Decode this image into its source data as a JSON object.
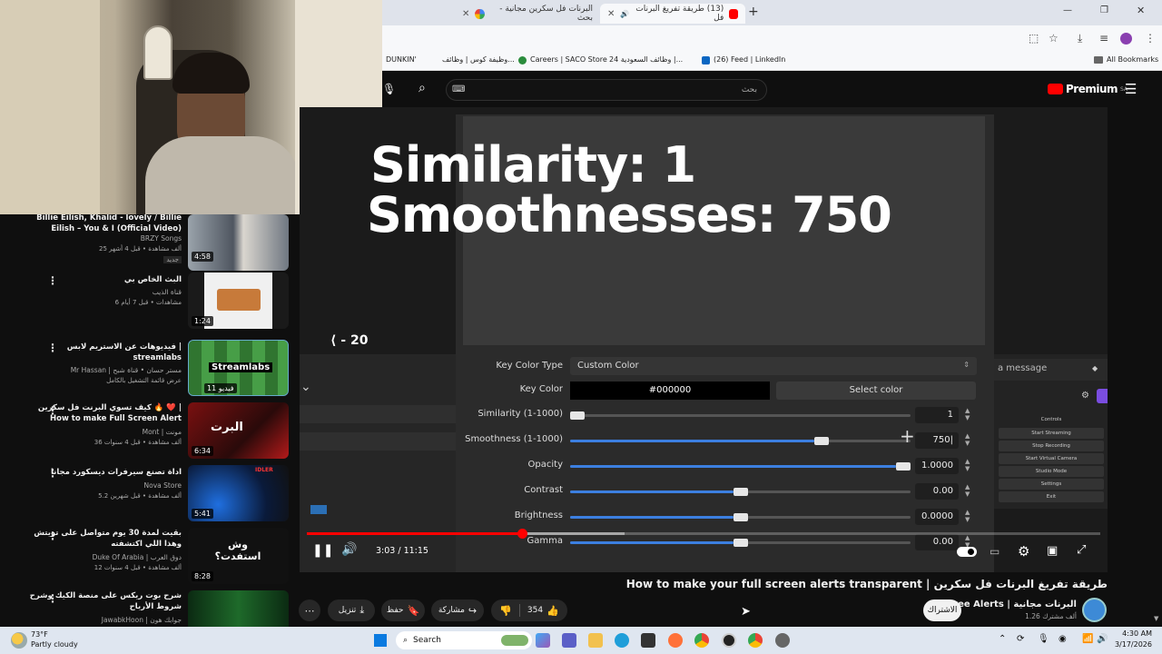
{
  "browser": {
    "tabs": [
      {
        "label": "البرنات فل سكرين مجانية - بحث",
        "active": false
      },
      {
        "label": "(13) طريقة تفريغ البرنات فل",
        "active": true
      }
    ],
    "new_tab": "+",
    "bookmarks": [
      "DUNKIN'",
      "وظيفة كوس | وظائف...",
      "Careers | SACO Store",
      "وظائف السعودية 24 |...",
      "(26) Feed | LinkedIn"
    ],
    "all_bookmarks": "All Bookmarks"
  },
  "youtube": {
    "premium_label": "Premium",
    "premium_region": "SA",
    "search_placeholder": "بحث"
  },
  "sidebar": {
    "videos": [
      {
        "title": "Billie Eilish, Khalid - lovely / Billie Eilish – You & I (Official Video)",
        "channel": "BRZY Songs",
        "meta": "25 ألف مشاهدة • قبل 4 أشهر",
        "badge": "جديد",
        "duration": "4:58"
      },
      {
        "title": "البث الخاص بي",
        "channel": "قناة الذيب",
        "meta": "6 مشاهدات • قبل 7 أيام",
        "badge": "",
        "duration": "1:24"
      },
      {
        "title": "فيديوهات عن الاستريم لابس | streamlabs",
        "channel": "Mr Hassan | مستر حسان • قناة شبح",
        "meta": "عرض قائمة التشغيل بالكامل",
        "badge": "",
        "duration": "11 فيديو"
      },
      {
        "title": "كيف تسوي البرنت فل سكرين 🔥 ❤️ | How to make Full Screen Alert",
        "channel": "Mont | مونت",
        "meta": "36 ألف مشاهدة • قبل 4 سنوات",
        "badge": "",
        "duration": "6:34"
      },
      {
        "title": "اداة تصنع سيرفرات ديسكورد مجانا",
        "channel": "Nova Store",
        "meta": "5.2 ألف مشاهدة • قبل شهرين",
        "badge": "",
        "duration": "5:41"
      },
      {
        "title": "بقيت لمدة 30 يوم متواصل على تويتش وهذا اللي اكتشفته",
        "channel": "Duke Of Arabia | دوق العرب",
        "meta": "12 ألف مشاهدة • قبل 4 سنوات",
        "badge": "",
        "duration": "8:28"
      },
      {
        "title": "شرح بوت ريكس على منصة الكيك وشرح شروط الأرباح",
        "channel": "JawabkHoon | جوابك هون",
        "meta": "",
        "badge": "",
        "duration": ""
      }
    ],
    "thumb_texts": {
      "stream": "Streamlabs",
      "bart": "البرت",
      "wesh": "وش استفدت؟",
      "idler": "IDLER"
    }
  },
  "player": {
    "overlay_line1": "Similarity: 1",
    "overlay_line2": "Smoothnesses: 750",
    "seek_back": "⟨ - 20",
    "time": "3:03 / 11:15",
    "progress": 0.271,
    "buffered": 0.4,
    "obs": {
      "key_color_type_label": "Key Color Type",
      "key_color_type_value": "Custom Color",
      "key_color_label": "Key Color",
      "key_color_value": "#000000",
      "select_color": "Select color",
      "rows": [
        {
          "label": "Similarity (1-1000)",
          "value": "1",
          "level": 0.0
        },
        {
          "label": "Smoothness (1-1000)",
          "value": "750|",
          "level": 0.75
        },
        {
          "label": "Opacity",
          "value": "1.0000",
          "level": 1.0
        },
        {
          "label": "Contrast",
          "value": "0.00",
          "level": 0.5
        },
        {
          "label": "Brightness",
          "value": "0.0000",
          "level": 0.5
        },
        {
          "label": "Gamma",
          "value": "0.00",
          "level": 0.5
        }
      ],
      "chat_placeholder": "a message",
      "controls_title": "Controls",
      "controls": [
        "Start Streaming",
        "Stop Recording",
        "Start Virtual Camera",
        "Studio Mode",
        "Settings",
        "Exit"
      ]
    }
  },
  "video": {
    "title": "How to make your full screen alerts transparent | طريقة تفريغ البرنات فل سكرين",
    "channel": "Free Alerts | البرنات مجانية",
    "subs": "1.26 ألف مشترك",
    "subscribe": "الاشتراك",
    "likes": "354",
    "share": "مشاركة",
    "save": "حفظ",
    "download": "تنزيل"
  },
  "taskbar": {
    "weather_temp": "73°F",
    "weather_desc": "Partly cloudy",
    "search": "Search",
    "time": "4:30 AM",
    "date": "3/17/2026"
  }
}
